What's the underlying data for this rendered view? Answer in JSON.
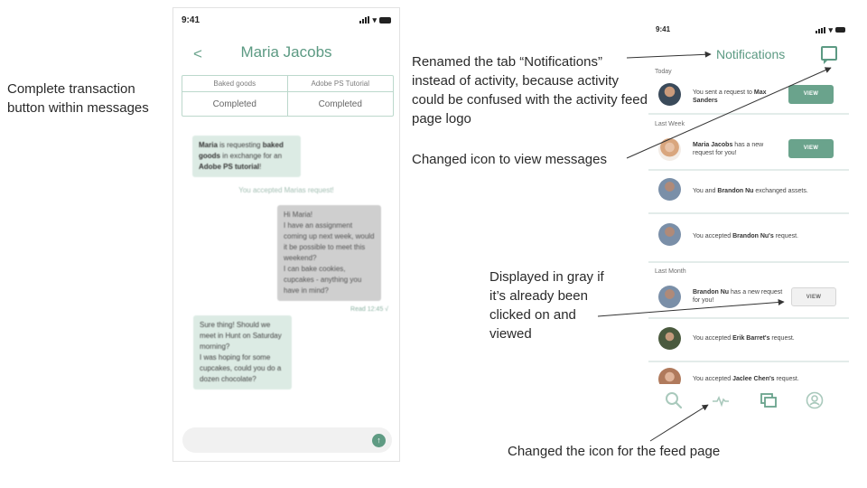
{
  "annotations": {
    "left": "Complete transaction button within messages",
    "rename": "Renamed the tab “Notifications” instead of activity, because activity could be confused with the activity feed page logo",
    "icon": "Changed icon to view messages",
    "gray": "Displayed in gray if it’s already been clicked on and viewed",
    "feed": "Changed the icon for the feed page"
  },
  "chat_screen": {
    "time": "9:41",
    "back": "<",
    "title": "Maria Jacobs",
    "deal": {
      "left_item": "Baked goods",
      "right_item": "Adobe PS Tutorial",
      "left_status": "Completed",
      "right_status": "Completed"
    },
    "messages": {
      "request_name": "Maria",
      "request_mid": " is requesting ",
      "request_item": "baked goods",
      "request_mid2": " in exchange for an ",
      "request_item2": "Adobe PS tutorial",
      "request_end": "!",
      "accepted": "You accepted Marias request!",
      "mine": "Hi Maria!\nI have an assignment coming up next week, would it be possible to meet this weekend?\nI can bake cookies, cupcakes - anything you have in mind?",
      "read": "Read 12:45 √",
      "reply": "Sure thing! Should we meet in Hunt on Saturday morning?\nI was hoping for some cupcakes, could you do a dozen chocolate?"
    }
  },
  "notifications_screen": {
    "time": "9:41",
    "title": "Notifications",
    "sections": {
      "today": "Today",
      "last_week": "Last Week",
      "last_month": "Last Month"
    },
    "items": [
      {
        "pre": "You sent a request to ",
        "bold": "Max Sanders",
        "post": "",
        "button": "VIEW"
      },
      {
        "pre": "",
        "bold": "Maria Jacobs",
        "post": " has a new request for you!",
        "button": "VIEW"
      },
      {
        "pre": "You and ",
        "bold": "Brandon Nu",
        "post": " exchanged assets.",
        "button": ""
      },
      {
        "pre": "You accepted ",
        "bold": "Brandon Nu's",
        "post": " request.",
        "button": ""
      },
      {
        "pre": "",
        "bold": "Brandon Nu",
        "post": "  has a new request for you!",
        "button": "VIEW"
      },
      {
        "pre": "You accepted ",
        "bold": "Erik Barret's",
        "post": " request.",
        "button": ""
      },
      {
        "pre": "You accepted ",
        "bold": "Jaclee Chen's",
        "post": " request.",
        "button": ""
      }
    ]
  },
  "colors": {
    "accent": "#5c9a83",
    "button_green": "#6aa38c",
    "button_gray": "#f1f1f1"
  }
}
